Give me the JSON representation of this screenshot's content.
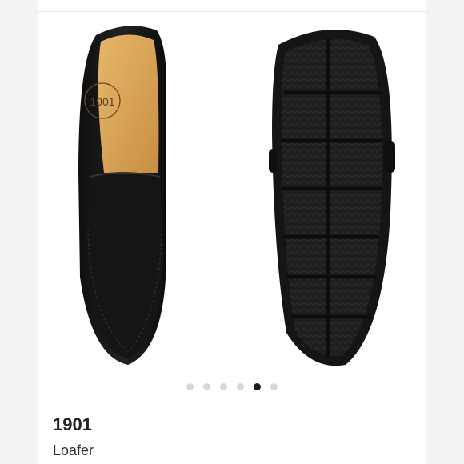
{
  "product": {
    "brand": "1901",
    "name": "Loafer",
    "insole_logo_text": "1901"
  },
  "carousel": {
    "slide_count": 6,
    "active_index": 4
  },
  "colors": {
    "shoe_leather": "#141414",
    "insole": "#d9a55a",
    "sole": "#1b1b1b",
    "dot_active": "#1a1a1a",
    "dot_inactive": "#d8d8d8"
  }
}
